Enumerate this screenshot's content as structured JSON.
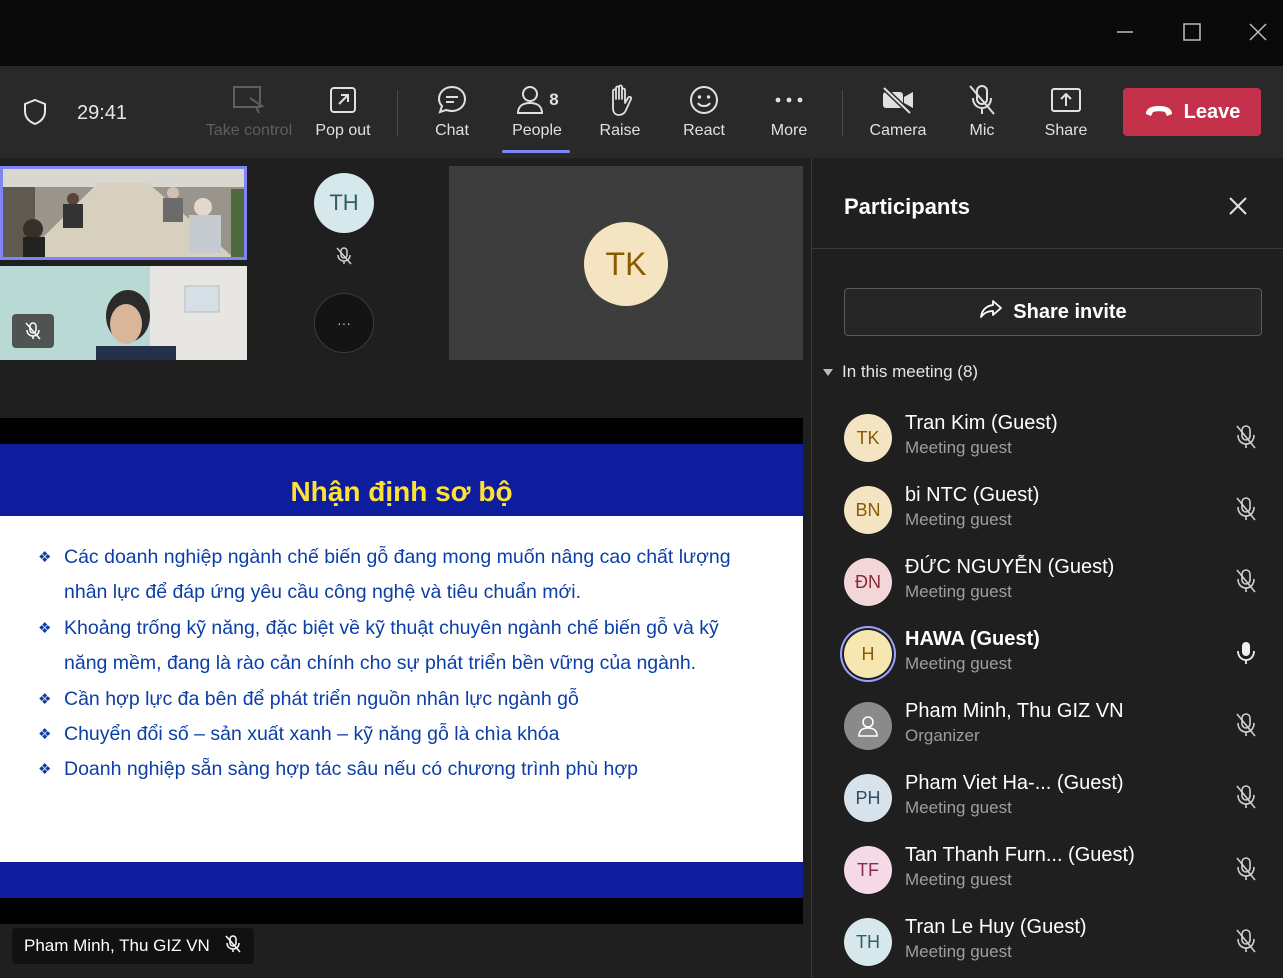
{
  "window": {
    "minimize_icon": "minimize-icon",
    "maximize_icon": "maximize-icon",
    "close_icon": "close-icon"
  },
  "toolbar": {
    "timer": "29:41",
    "take_control": "Take control",
    "pop_out": "Pop out",
    "chat": "Chat",
    "people": "People",
    "people_count": "8",
    "raise": "Raise",
    "react": "React",
    "more": "More",
    "camera": "Camera",
    "mic": "Mic",
    "share": "Share",
    "leave": "Leave"
  },
  "stage": {
    "tiles": {
      "th_initials": "TH",
      "tk_initials": "TK",
      "overflow": "···"
    },
    "slide": {
      "title": "Nhận định sơ bộ",
      "bullets": [
        "Các doanh nghiệp ngành chế biến gỗ đang mong muốn nâng cao chất lượng nhân lực để đáp ứng yêu cầu công nghệ và tiêu chuẩn mới.",
        "Khoảng trống kỹ năng, đặc biệt về kỹ thuật chuyên ngành chế biến gỗ và kỹ năng mềm, đang là rào cản chính cho sự phát triển bền vững của ngành.",
        "Cần hợp lực đa bên để phát triển nguồn nhân lực ngành gỗ",
        "Chuyển đổi số – sản xuất xanh – kỹ năng gỗ là chìa khóa",
        "Doanh nghiệp sẵn sàng hợp tác sâu nếu có chương trình phù hợp"
      ]
    },
    "presenter_name": "Pham Minh, Thu GIZ VN"
  },
  "panel": {
    "title": "Participants",
    "share_invite": "Share invite",
    "section_label": "In this meeting (8)",
    "participants": [
      {
        "initials": "TK",
        "name": "Tran Kim (Guest)",
        "role": "Meeting guest",
        "bg": "#f4e4c1",
        "fg": "#8a5a00",
        "muted": true
      },
      {
        "initials": "BN",
        "name": "bi NTC (Guest)",
        "role": "Meeting guest",
        "bg": "#f4e4c1",
        "fg": "#8a5a00",
        "muted": true
      },
      {
        "initials": "ĐN",
        "name": "ĐỨC NGUYỄN (Guest)",
        "role": "Meeting guest",
        "bg": "#f3d6d8",
        "fg": "#8b2a36",
        "muted": true
      },
      {
        "initials": "H",
        "name": "HAWA (Guest)",
        "role": "Meeting guest",
        "bg": "#f6e6b0",
        "fg": "#8a5a00",
        "muted": false
      },
      {
        "initials": "",
        "name": "Pham Minh, Thu GIZ VN",
        "role": "Organizer",
        "bg": "#8a8a8a",
        "fg": "#ffffff",
        "muted": true
      },
      {
        "initials": "PH",
        "name": "Pham Viet Ha-...  (Guest)",
        "role": "Meeting guest",
        "bg": "#d7e3ec",
        "fg": "#2f4e66",
        "muted": true
      },
      {
        "initials": "TF",
        "name": "Tan Thanh Furn... (Guest)",
        "role": "Meeting guest",
        "bg": "#f6d9e6",
        "fg": "#8b2a5a",
        "muted": true
      },
      {
        "initials": "TH",
        "name": "Tran Le Huy (Guest)",
        "role": "Meeting guest",
        "bg": "#d7e8ec",
        "fg": "#2f5e66",
        "muted": true
      }
    ]
  }
}
